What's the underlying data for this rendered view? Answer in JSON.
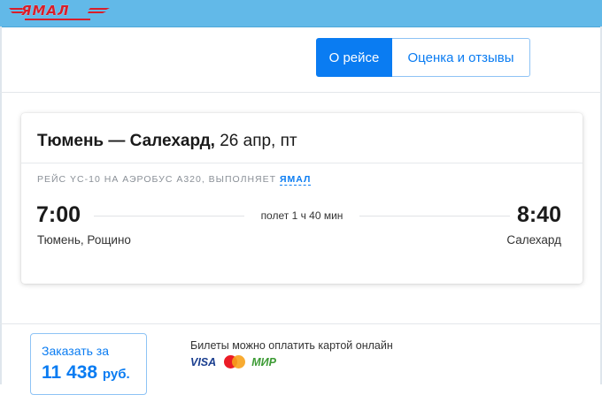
{
  "header": {
    "logo_text": "ЯМАЛ"
  },
  "tabs": [
    {
      "label": "О рейсе",
      "active": true
    },
    {
      "label": "Оценка и отзывы",
      "active": false
    }
  ],
  "flight": {
    "route": "Тюмень — Салехард,",
    "date": "26 апр, пт",
    "info_prefix": "Рейс YC-10 на Аэробус A320, выполняет",
    "airline": "ЯМАЛ",
    "departure_time": "7:00",
    "arrival_time": "8:40",
    "duration": "полет 1 ч 40 мин",
    "departure_city": "Тюмень, Рощино",
    "arrival_city": "Салехард"
  },
  "order": {
    "label": "Заказать за",
    "price": "11 438",
    "currency": "руб."
  },
  "payment": {
    "text": "Билеты можно оплатить картой онлайн",
    "visa": "VISA",
    "mir": "МИР"
  },
  "colors": {
    "accent": "#0a7cf2",
    "header_bg": "#62b9e8",
    "logo_red": "#d91e2a"
  }
}
